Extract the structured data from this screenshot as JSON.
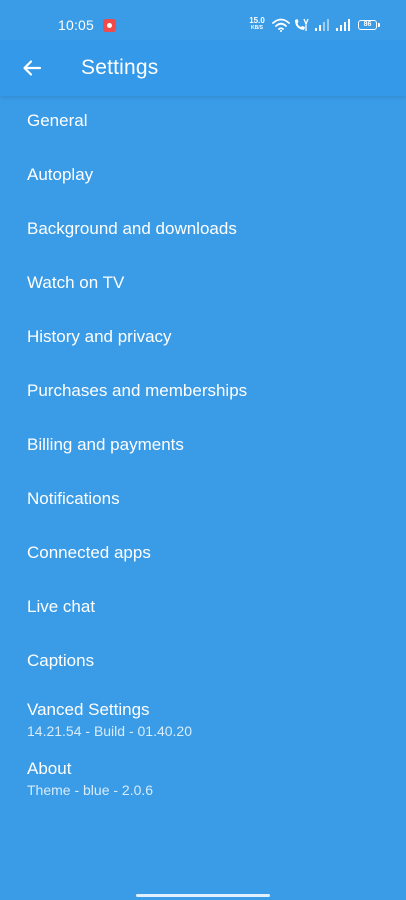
{
  "status_bar": {
    "time": "10:05",
    "net_speed_value": "15.0",
    "net_speed_unit": "KB/S",
    "battery": "86"
  },
  "app_bar": {
    "title": "Settings"
  },
  "colors": {
    "background": "#3a9be6",
    "app_bar": "#3399e8",
    "text": "#ffffff",
    "subtext": "#d8ecfb"
  },
  "settings": {
    "items": [
      {
        "label": "General"
      },
      {
        "label": "Autoplay"
      },
      {
        "label": "Background and downloads"
      },
      {
        "label": "Watch on TV"
      },
      {
        "label": "History and privacy"
      },
      {
        "label": "Purchases and memberships"
      },
      {
        "label": "Billing and payments"
      },
      {
        "label": "Notifications"
      },
      {
        "label": "Connected apps"
      },
      {
        "label": "Live chat"
      },
      {
        "label": "Captions"
      },
      {
        "label": "Vanced Settings",
        "subtitle": "14.21.54 - Build - 01.40.20"
      },
      {
        "label": "About",
        "subtitle": "Theme - blue - 2.0.6"
      }
    ]
  }
}
